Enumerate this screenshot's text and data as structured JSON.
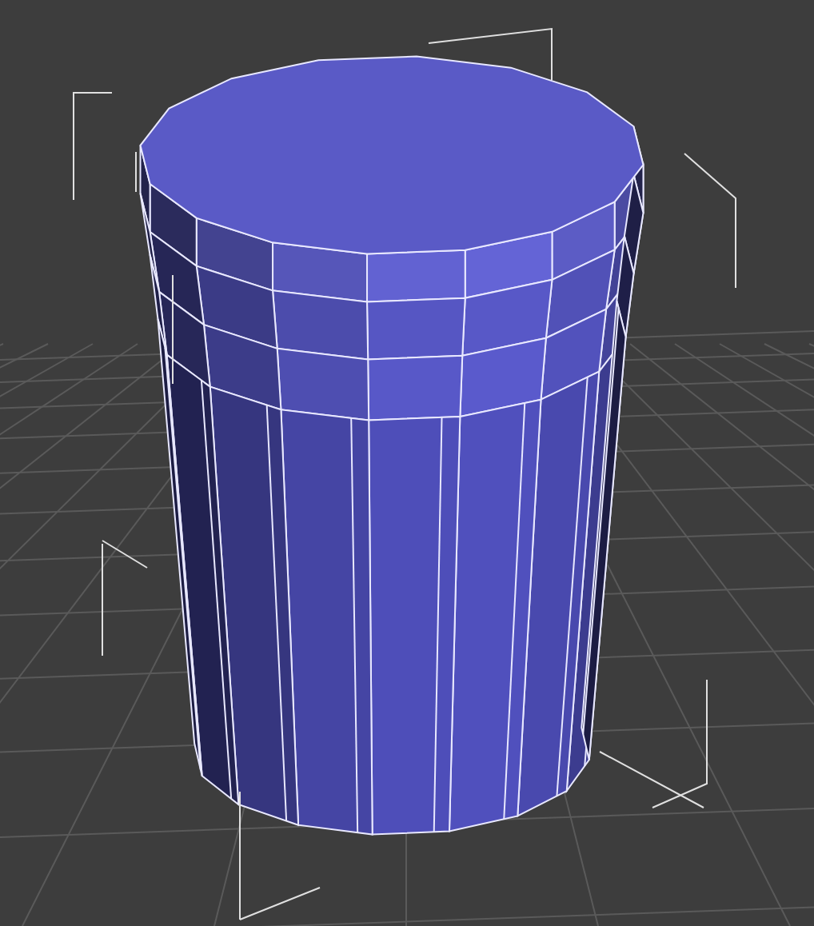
{
  "viewport": {
    "grid_visible": true,
    "object_selected": true
  }
}
